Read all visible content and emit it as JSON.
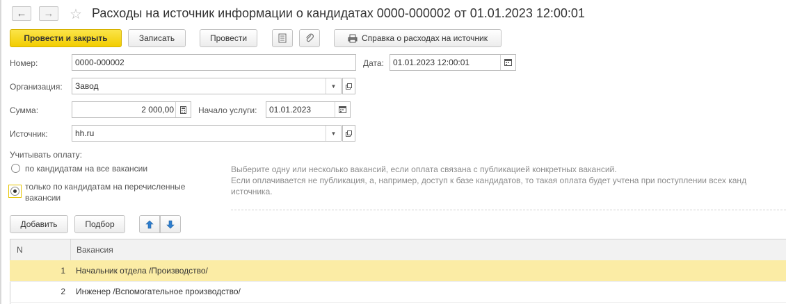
{
  "window": {
    "title": "Расходы на источник информации о кандидатах 0000-000002 от 01.01.2023 12:00:01"
  },
  "toolbar": {
    "post_close_label": "Провести и закрыть",
    "save_label": "Записать",
    "post_label": "Провести",
    "report_label": "Справка о расходах на источник"
  },
  "form": {
    "number_label": "Номер:",
    "number_value": "0000-000002",
    "date_label": "Дата:",
    "date_value": "01.01.2023 12:00:01",
    "org_label": "Организация:",
    "org_value": "Завод",
    "sum_label": "Сумма:",
    "sum_value": "2 000,00",
    "start_label": "Начало услуги:",
    "start_value": "01.01.2023",
    "source_label": "Источник:",
    "source_value": "hh.ru"
  },
  "payment": {
    "label": "Учитывать оплату:",
    "option_all": "по кандидатам на все вакансии",
    "option_listed_line1": "только по кандидатам на перечисленные",
    "option_listed_line2": "вакансии",
    "selected": "listed",
    "hint_line1": "Выберите одну или несколько вакансий, если оплата связана с публикацией конкретных вакансий.",
    "hint_line2": "Если оплачивается не публикация, а, например, доступ к базе кандидатов, то такая оплата будет учтена при поступлении всех канд",
    "hint_line3": "источника."
  },
  "table_toolbar": {
    "add_label": "Добавить",
    "pick_label": "Подбор"
  },
  "table": {
    "headers": {
      "n": "N",
      "vacancy": "Вакансия"
    },
    "rows": [
      {
        "n": "1",
        "vacancy": "Начальник отдела /Производство/",
        "selected": true
      },
      {
        "n": "2",
        "vacancy": "Инженер /Вспомогательное производство/",
        "selected": false
      }
    ]
  },
  "colors": {
    "primary_button": "#f2cd00",
    "selected_row": "#fbeca5",
    "arrow_blue": "#2f7fd0"
  }
}
